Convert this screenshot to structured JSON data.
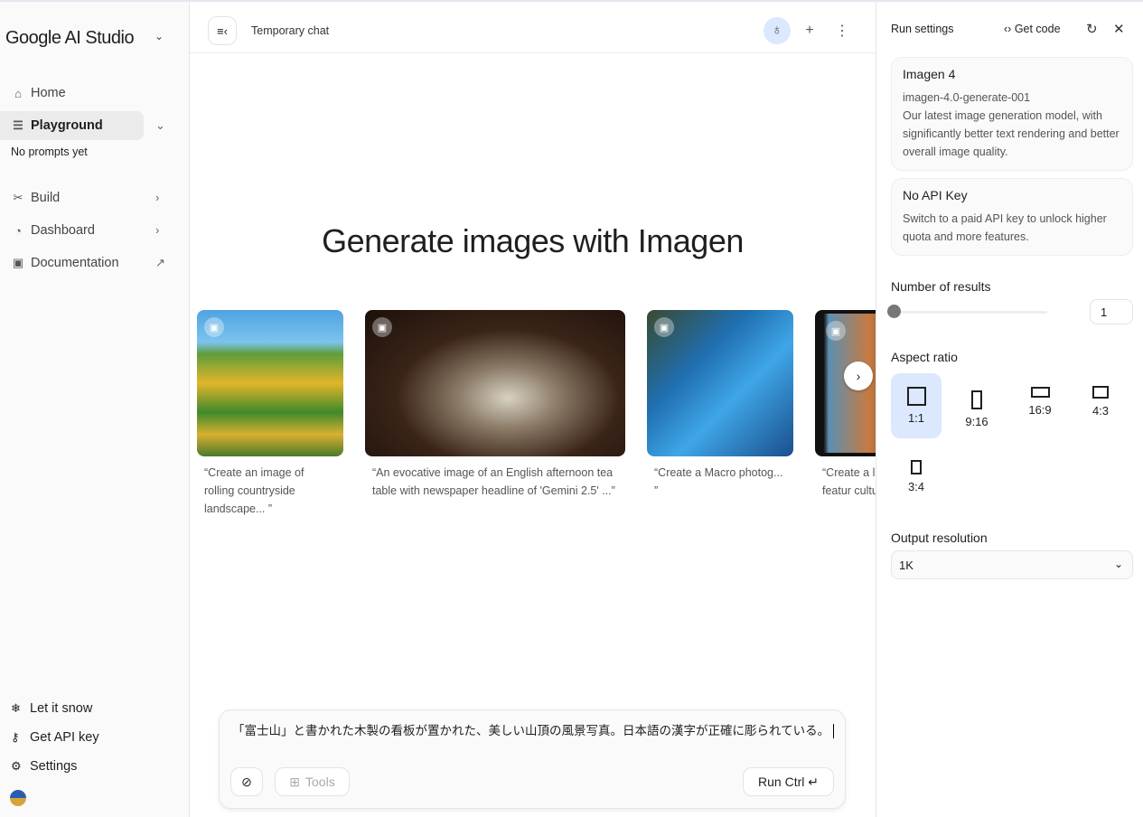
{
  "sidebar": {
    "brand": "Google AI Studio",
    "nav": [
      {
        "label": "Home",
        "icon": "home-icon"
      },
      {
        "label": "Playground",
        "icon": "playground-icon"
      },
      {
        "label": "Build",
        "icon": "build-icon"
      },
      {
        "label": "Dashboard",
        "icon": "dashboard-icon"
      },
      {
        "label": "Documentation",
        "icon": "book-icon"
      }
    ],
    "no_prompts": "No prompts yet",
    "footer": [
      {
        "label": "Let it snow",
        "icon": "snowflake-icon"
      },
      {
        "label": "Get API key",
        "icon": "key-icon"
      },
      {
        "label": "Settings",
        "icon": "gear-icon"
      }
    ]
  },
  "topbar": {
    "title": "Temporary chat"
  },
  "main": {
    "heading": "Generate images with Imagen",
    "examples": [
      {
        "caption": "“Create an image of rolling countryside landscape... ”"
      },
      {
        "caption": "“An evocative image of an English afternoon tea table with newspaper headline of 'Gemini 2.5' ...”"
      },
      {
        "caption": "“Create a Macro photog... ”"
      },
      {
        "caption": "“Create a l that featur culture...”"
      }
    ]
  },
  "composer": {
    "prompt": "「富士山」と書かれた木製の看板が置かれた、美しい山頂の風景写真。日本語の漢字が正確に彫られている。",
    "tools_label": "Tools",
    "run_label": "Run Ctrl ↵"
  },
  "run_settings": {
    "title": "Run settings",
    "get_code": "Get code",
    "model": {
      "name": "Imagen 4",
      "id": "imagen-4.0-generate-001",
      "description": "Our latest image generation model, with significantly better text rendering and better overall image quality."
    },
    "api_key": {
      "title": "No API Key",
      "description": "Switch to a paid API key to unlock higher quota and more features."
    },
    "number_of_results_label": "Number of results",
    "number_of_results": "1",
    "aspect_ratio_label": "Aspect ratio",
    "aspect_ratios": [
      "1:1",
      "9:16",
      "16:9",
      "4:3",
      "3:4"
    ],
    "selected_aspect": "1:1",
    "output_resolution_label": "Output resolution",
    "output_resolution": "1K"
  },
  "colors": {
    "accent_selected": "#dbe8fd"
  }
}
